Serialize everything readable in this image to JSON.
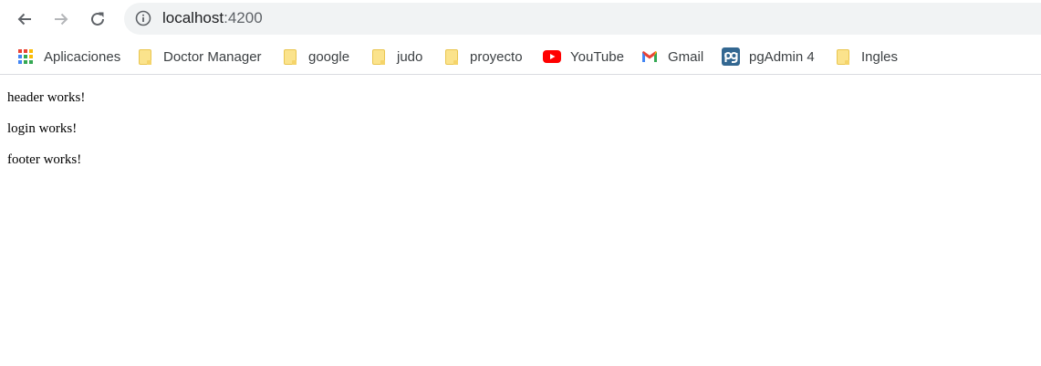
{
  "browser": {
    "url_host": "localhost",
    "url_port": ":4200"
  },
  "bookmarks": [
    {
      "label": "Aplicaciones",
      "icon": "apps-grid-icon"
    },
    {
      "label": "Doctor Manager",
      "icon": "folder-icon"
    },
    {
      "label": "google",
      "icon": "folder-icon"
    },
    {
      "label": "judo",
      "icon": "folder-icon"
    },
    {
      "label": "proyecto",
      "icon": "folder-icon"
    },
    {
      "label": "YouTube",
      "icon": "youtube-icon"
    },
    {
      "label": "Gmail",
      "icon": "gmail-icon"
    },
    {
      "label": "pgAdmin 4",
      "icon": "pgadmin-icon"
    },
    {
      "label": "Ingles",
      "icon": "folder-icon"
    }
  ],
  "page": {
    "lines": [
      "header works!",
      "login works!",
      "footer works!"
    ]
  }
}
